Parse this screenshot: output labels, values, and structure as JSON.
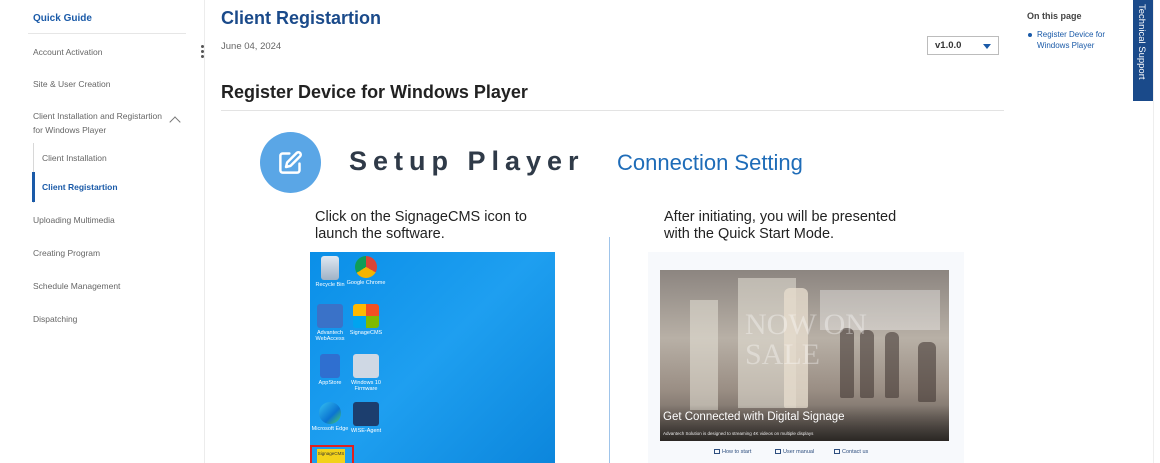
{
  "sidebar": {
    "title": "Quick Guide",
    "items": [
      "Account Activation",
      "Site & User Creation",
      "Client Installation and Registartion for Windows Player",
      "Uploading Multimedia",
      "Creating Program",
      "Schedule Management",
      "Dispatching"
    ],
    "subitems": [
      "Client Installation",
      "Client Registartion"
    ]
  },
  "main": {
    "title": "Client Registartion",
    "date": "June 04, 2024",
    "version": "v1.0.0",
    "section_heading": "Register Device for Windows Player"
  },
  "illustration": {
    "setup_title": "Setup Player",
    "connection_title": "Connection Setting",
    "left_caption_1": "Click on the SignageCMS icon to",
    "left_caption_2": "launch the software.",
    "right_caption_1": "After initiating, you will be presented",
    "right_caption_2": "with the Quick Start Mode.",
    "desktop_icons": [
      "Recycle Bin",
      "Google Chrome",
      "Advantech WebAccess",
      "SignageCMS",
      "AppStore",
      "Windows 10 Firmware",
      "Microsoft Edge",
      "WISE-Agent"
    ],
    "signage_icon_label": "SignageCMS",
    "quickstart_tagline": "Get Connected with Digital Signage",
    "quickstart_sub": "Advantech Solution is designed to streaming 4K videos on multiple displays",
    "quickstart_links": [
      "How to start",
      "User manual",
      "Contact us"
    ],
    "photo_text": "NOW ON SALE"
  },
  "toc": {
    "heading": "On this page",
    "link": "Register Device for Windows Player"
  },
  "tech_support": "Technical Support",
  "colors": {
    "primary": "#1a4a8a",
    "accent": "#1a5aa8",
    "circle": "#5aa6e6",
    "desktop": "#0a8fe8"
  }
}
